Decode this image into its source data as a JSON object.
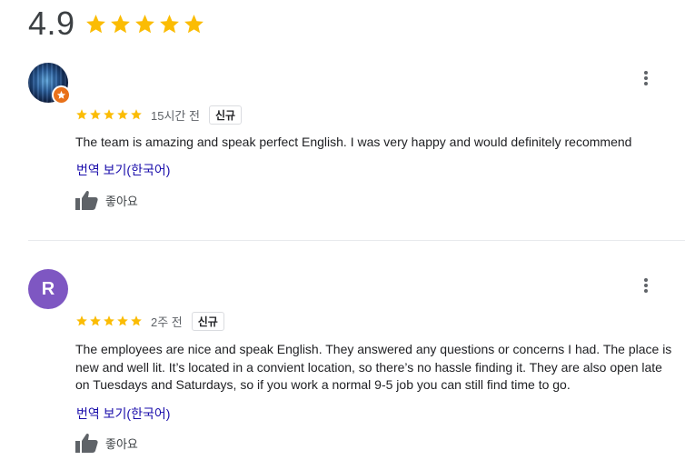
{
  "summary": {
    "score": "4.9",
    "stars": 5,
    "star_color": "#fbbc04"
  },
  "reviews": [
    {
      "avatar_type": "photo",
      "rating": 5,
      "time": "15시간 전",
      "badge": "신규",
      "text": "The team is amazing and speak perfect English. I was very happy and would definitely recommend",
      "translate": "번역 보기(한국어)",
      "like": "좋아요"
    },
    {
      "avatar_type": "letter",
      "avatar_letter": "R",
      "avatar_color": "#7e57c2",
      "rating": 5,
      "time": "2주 전",
      "badge": "신규",
      "text": "The employees are nice and speak English. They answered any questions or concerns I had. The place is new and well lit. It’s located in a convient location, so there’s no hassle finding it. They are also open late on Tuesdays and  Saturdays, so if you work a normal 9-5 job you can still find time to go.",
      "translate": "번역 보기(한국어)",
      "like": "좋아요"
    }
  ],
  "icons": {
    "star": "star-icon",
    "more": "more-vert-icon",
    "like": "thumb-up-icon",
    "guide": "local-guide-badge-icon"
  }
}
